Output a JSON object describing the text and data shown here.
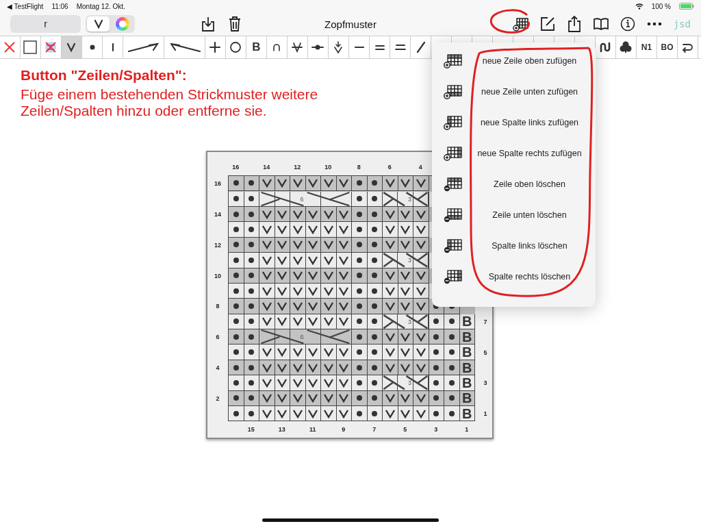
{
  "status_bar": {
    "back_app": "◀ TestFlight",
    "time": "11:06",
    "date": "Montag 12. Okt.",
    "battery": "100 %"
  },
  "nav_bar": {
    "name_field": {
      "value": "r"
    },
    "segments": [
      {
        "kind": "knit",
        "selected": true
      },
      {
        "kind": "color-wheel",
        "selected": false
      }
    ],
    "title": "Zopfmuster",
    "logo": "jsd"
  },
  "palette": [
    {
      "kind": "cross",
      "selected": false
    },
    {
      "kind": "box",
      "selected": false
    },
    {
      "kind": "no-color",
      "selected": false
    },
    {
      "kind": "knit",
      "selected": true
    },
    {
      "kind": "purl",
      "selected": false
    },
    {
      "kind": "bar",
      "selected": false
    },
    {
      "kind": "slant-right-long",
      "selected": false
    },
    {
      "kind": "slant-left-long",
      "selected": false
    },
    {
      "kind": "plus",
      "selected": false
    },
    {
      "kind": "circle",
      "selected": false
    },
    {
      "kind": "text",
      "label": "B",
      "selected": false
    },
    {
      "kind": "arc",
      "selected": false
    },
    {
      "kind": "knit-bar",
      "selected": false
    },
    {
      "kind": "dot-bar",
      "selected": false
    },
    {
      "kind": "arrow-knit",
      "selected": false
    },
    {
      "kind": "dash",
      "selected": false
    },
    {
      "kind": "double-dash",
      "selected": false
    },
    {
      "kind": "underline-dash",
      "selected": false
    },
    {
      "kind": "slash",
      "selected": false
    },
    {
      "kind": "covered",
      "selected": false
    },
    {
      "kind": "covered",
      "selected": false
    },
    {
      "kind": "covered",
      "selected": false
    },
    {
      "kind": "covered",
      "selected": false
    },
    {
      "kind": "covered",
      "selected": false
    },
    {
      "kind": "covered",
      "selected": false
    },
    {
      "kind": "covered",
      "selected": false
    },
    {
      "kind": "covered",
      "selected": false
    },
    {
      "kind": "wave",
      "selected": false
    },
    {
      "kind": "cluster",
      "selected": false
    },
    {
      "kind": "text",
      "label": "N1",
      "selected": false
    },
    {
      "kind": "text",
      "label": "BO",
      "selected": false
    },
    {
      "kind": "turn",
      "selected": false
    }
  ],
  "annotation": {
    "heading": "Button \"Zeilen/Spalten\":",
    "text": "Füge einem bestehenden Strickmuster weitere Zeilen/Spalten hinzu oder entferne sie."
  },
  "chart": {
    "top_labels": [
      "16",
      "14",
      "12",
      "10",
      "8",
      "6",
      "4"
    ],
    "rows": [
      {
        "left_label": "16",
        "shaded": true,
        "cells": [
          {
            "kind": "purl"
          },
          {
            "kind": "purl"
          },
          {
            "kind": "knit"
          },
          {
            "kind": "knit"
          },
          {
            "kind": "knit"
          },
          {
            "kind": "knit"
          },
          {
            "kind": "knit"
          },
          {
            "kind": "knit"
          },
          {
            "kind": "purl"
          },
          {
            "kind": "purl"
          },
          {
            "kind": "knit"
          },
          {
            "kind": "knit"
          },
          {
            "kind": "knit"
          }
        ]
      },
      {
        "shaded": false,
        "cable_labels": [
          "6",
          "3"
        ],
        "cells": [
          {
            "kind": "purl"
          },
          {
            "kind": "purl"
          },
          {
            "kind": "cable"
          },
          {
            "kind": "cable"
          },
          {
            "kind": "cable"
          },
          {
            "kind": "cable"
          },
          {
            "kind": "cable"
          },
          {
            "kind": "cable"
          },
          {
            "kind": "purl"
          },
          {
            "kind": "purl"
          },
          {
            "kind": "cable"
          },
          {
            "kind": "cable"
          },
          {
            "kind": "cable"
          }
        ]
      },
      {
        "left_label": "14",
        "shaded": true,
        "cells": [
          {
            "kind": "purl"
          },
          {
            "kind": "purl"
          },
          {
            "kind": "knit"
          },
          {
            "kind": "knit"
          },
          {
            "kind": "knit"
          },
          {
            "kind": "knit"
          },
          {
            "kind": "knit"
          },
          {
            "kind": "knit"
          },
          {
            "kind": "purl"
          },
          {
            "kind": "purl"
          },
          {
            "kind": "knit"
          },
          {
            "kind": "knit"
          },
          {
            "kind": "knit"
          }
        ]
      },
      {
        "shaded": false,
        "cells": [
          {
            "kind": "purl"
          },
          {
            "kind": "purl"
          },
          {
            "kind": "knit"
          },
          {
            "kind": "knit"
          },
          {
            "kind": "knit"
          },
          {
            "kind": "knit"
          },
          {
            "kind": "knit"
          },
          {
            "kind": "knit"
          },
          {
            "kind": "purl"
          },
          {
            "kind": "purl"
          },
          {
            "kind": "knit"
          },
          {
            "kind": "knit"
          },
          {
            "kind": "knit"
          }
        ]
      },
      {
        "left_label": "12",
        "shaded": true,
        "cells": [
          {
            "kind": "purl"
          },
          {
            "kind": "purl"
          },
          {
            "kind": "knit"
          },
          {
            "kind": "knit"
          },
          {
            "kind": "knit"
          },
          {
            "kind": "knit"
          },
          {
            "kind": "knit"
          },
          {
            "kind": "knit"
          },
          {
            "kind": "purl"
          },
          {
            "kind": "purl"
          },
          {
            "kind": "knit"
          },
          {
            "kind": "knit"
          },
          {
            "kind": "knit"
          }
        ]
      },
      {
        "shaded": false,
        "cable_labels": [
          "3"
        ],
        "cells": [
          {
            "kind": "purl"
          },
          {
            "kind": "purl"
          },
          {
            "kind": "knit"
          },
          {
            "kind": "knit"
          },
          {
            "kind": "knit"
          },
          {
            "kind": "knit"
          },
          {
            "kind": "knit"
          },
          {
            "kind": "knit"
          },
          {
            "kind": "purl"
          },
          {
            "kind": "purl"
          },
          {
            "kind": "cable"
          },
          {
            "kind": "cable"
          },
          {
            "kind": "cable"
          }
        ]
      },
      {
        "left_label": "10",
        "shaded": true,
        "cells": [
          {
            "kind": "purl"
          },
          {
            "kind": "purl"
          },
          {
            "kind": "knit"
          },
          {
            "kind": "knit"
          },
          {
            "kind": "knit"
          },
          {
            "kind": "knit"
          },
          {
            "kind": "knit"
          },
          {
            "kind": "knit"
          },
          {
            "kind": "purl"
          },
          {
            "kind": "purl"
          },
          {
            "kind": "knit"
          },
          {
            "kind": "knit"
          },
          {
            "kind": "knit"
          }
        ]
      },
      {
        "shaded": false,
        "cells": [
          {
            "kind": "purl"
          },
          {
            "kind": "purl"
          },
          {
            "kind": "knit"
          },
          {
            "kind": "knit"
          },
          {
            "kind": "knit"
          },
          {
            "kind": "knit"
          },
          {
            "kind": "knit"
          },
          {
            "kind": "knit"
          },
          {
            "kind": "purl"
          },
          {
            "kind": "purl"
          },
          {
            "kind": "knit"
          },
          {
            "kind": "knit"
          },
          {
            "kind": "knit"
          }
        ]
      },
      {
        "left_label": "8",
        "shaded": true,
        "cells": [
          {
            "kind": "purl"
          },
          {
            "kind": "purl"
          },
          {
            "kind": "knit"
          },
          {
            "kind": "knit"
          },
          {
            "kind": "knit"
          },
          {
            "kind": "knit"
          },
          {
            "kind": "knit"
          },
          {
            "kind": "knit"
          },
          {
            "kind": "purl"
          },
          {
            "kind": "purl"
          },
          {
            "kind": "knit"
          },
          {
            "kind": "knit"
          },
          {
            "kind": "knit"
          },
          {
            "kind": "purl"
          },
          {
            "kind": "purl"
          }
        ]
      },
      {
        "right_label": "7",
        "shaded": false,
        "cable_labels": [
          "3"
        ],
        "cells": [
          {
            "kind": "purl"
          },
          {
            "kind": "purl"
          },
          {
            "kind": "knit"
          },
          {
            "kind": "knit"
          },
          {
            "kind": "knit"
          },
          {
            "kind": "knit"
          },
          {
            "kind": "knit"
          },
          {
            "kind": "knit"
          },
          {
            "kind": "purl"
          },
          {
            "kind": "purl"
          },
          {
            "kind": "cable"
          },
          {
            "kind": "cable"
          },
          {
            "kind": "cable"
          },
          {
            "kind": "purl"
          },
          {
            "kind": "purl"
          },
          {
            "kind": "text",
            "label": "B"
          }
        ]
      },
      {
        "left_label": "6",
        "shaded": true,
        "cable_labels": [
          "6"
        ],
        "cells": [
          {
            "kind": "purl"
          },
          {
            "kind": "purl"
          },
          {
            "kind": "cable"
          },
          {
            "kind": "cable"
          },
          {
            "kind": "cable"
          },
          {
            "kind": "cable"
          },
          {
            "kind": "cable"
          },
          {
            "kind": "cable"
          },
          {
            "kind": "purl"
          },
          {
            "kind": "purl"
          },
          {
            "kind": "knit"
          },
          {
            "kind": "knit"
          },
          {
            "kind": "knit"
          },
          {
            "kind": "purl"
          },
          {
            "kind": "purl"
          },
          {
            "kind": "text",
            "label": "B"
          }
        ]
      },
      {
        "right_label": "5",
        "shaded": false,
        "cells": [
          {
            "kind": "purl"
          },
          {
            "kind": "purl"
          },
          {
            "kind": "knit"
          },
          {
            "kind": "knit"
          },
          {
            "kind": "knit"
          },
          {
            "kind": "knit"
          },
          {
            "kind": "knit"
          },
          {
            "kind": "knit"
          },
          {
            "kind": "purl"
          },
          {
            "kind": "purl"
          },
          {
            "kind": "knit"
          },
          {
            "kind": "knit"
          },
          {
            "kind": "knit"
          },
          {
            "kind": "purl"
          },
          {
            "kind": "purl"
          },
          {
            "kind": "text",
            "label": "B"
          }
        ]
      },
      {
        "left_label": "4",
        "shaded": true,
        "cells": [
          {
            "kind": "purl"
          },
          {
            "kind": "purl"
          },
          {
            "kind": "knit"
          },
          {
            "kind": "knit"
          },
          {
            "kind": "knit"
          },
          {
            "kind": "knit"
          },
          {
            "kind": "knit"
          },
          {
            "kind": "knit"
          },
          {
            "kind": "purl"
          },
          {
            "kind": "purl"
          },
          {
            "kind": "knit"
          },
          {
            "kind": "knit"
          },
          {
            "kind": "knit"
          },
          {
            "kind": "purl"
          },
          {
            "kind": "purl"
          },
          {
            "kind": "text",
            "label": "B"
          }
        ]
      },
      {
        "right_label": "3",
        "shaded": false,
        "cable_labels": [
          "3"
        ],
        "cells": [
          {
            "kind": "purl"
          },
          {
            "kind": "purl"
          },
          {
            "kind": "knit"
          },
          {
            "kind": "knit"
          },
          {
            "kind": "knit"
          },
          {
            "kind": "knit"
          },
          {
            "kind": "knit"
          },
          {
            "kind": "knit"
          },
          {
            "kind": "purl"
          },
          {
            "kind": "purl"
          },
          {
            "kind": "cable"
          },
          {
            "kind": "cable"
          },
          {
            "kind": "cable"
          },
          {
            "kind": "purl"
          },
          {
            "kind": "purl"
          },
          {
            "kind": "text",
            "label": "B"
          }
        ]
      },
      {
        "left_label": "2",
        "shaded": true,
        "cells": [
          {
            "kind": "purl"
          },
          {
            "kind": "purl"
          },
          {
            "kind": "knit"
          },
          {
            "kind": "knit"
          },
          {
            "kind": "knit"
          },
          {
            "kind": "knit"
          },
          {
            "kind": "knit"
          },
          {
            "kind": "knit"
          },
          {
            "kind": "purl"
          },
          {
            "kind": "purl"
          },
          {
            "kind": "knit"
          },
          {
            "kind": "knit"
          },
          {
            "kind": "knit"
          },
          {
            "kind": "purl"
          },
          {
            "kind": "purl"
          },
          {
            "kind": "text",
            "label": "B"
          }
        ]
      },
      {
        "right_label": "1",
        "shaded": false,
        "cells": [
          {
            "kind": "purl"
          },
          {
            "kind": "purl"
          },
          {
            "kind": "knit"
          },
          {
            "kind": "knit"
          },
          {
            "kind": "knit"
          },
          {
            "kind": "knit"
          },
          {
            "kind": "knit"
          },
          {
            "kind": "knit"
          },
          {
            "kind": "purl"
          },
          {
            "kind": "purl"
          },
          {
            "kind": "knit"
          },
          {
            "kind": "knit"
          },
          {
            "kind": "knit"
          },
          {
            "kind": "purl"
          },
          {
            "kind": "purl"
          },
          {
            "kind": "text",
            "label": "B"
          }
        ]
      }
    ],
    "bottom_labels": [
      "15",
      "13",
      "11",
      "9",
      "7",
      "5",
      "3",
      "1"
    ]
  },
  "menu": {
    "items": [
      {
        "kind": "add-top",
        "label": "neue Zeile oben zufügen"
      },
      {
        "kind": "add-bottom",
        "label": "neue Zeile unten zufügen"
      },
      {
        "kind": "add-left",
        "label": "neue Spalte links zufügen"
      },
      {
        "kind": "add-right",
        "label": "neue Spalte rechts zufügen"
      },
      {
        "kind": "remove-top",
        "label": "Zeile oben löschen"
      },
      {
        "kind": "remove-bottom",
        "label": "Zeile unten löschen"
      },
      {
        "kind": "remove-left",
        "label": "Spalte links löschen"
      },
      {
        "kind": "remove-right",
        "label": "Spalte rechts löschen"
      }
    ]
  }
}
